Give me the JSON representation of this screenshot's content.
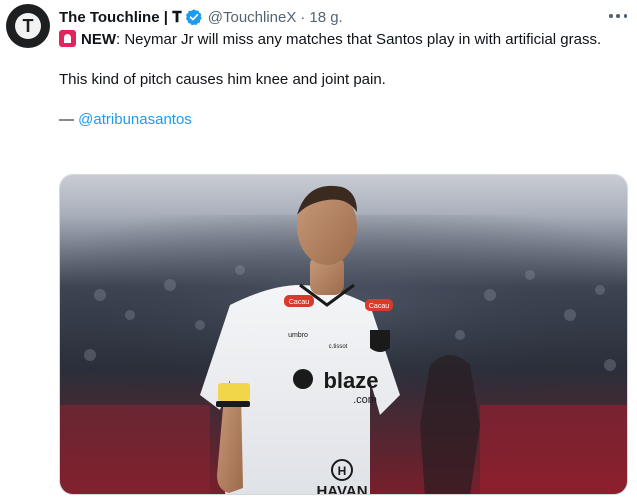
{
  "author": {
    "display_name": "The Touchline | 𝐓",
    "handle": "@TouchlineX",
    "separator": "·",
    "time": "18 g.",
    "avatar_letter": "T",
    "verified": true
  },
  "tweet": {
    "new_label": "NEW",
    "line1_rest": ": Neymar Jr will miss any matches that Santos play in with artificial grass.",
    "paragraph2": "This kind of pitch causes him knee and joint pain.",
    "credit_dash": "— ",
    "credit_link": "@atribunasantos"
  },
  "media": {
    "shirt_sponsor": "blaze",
    "shirt_sponsor_sub": ".com",
    "shirt_brand": "HAVAN",
    "shirt_brand_mark": "H",
    "kit_maker": "umbro",
    "kit_sponsor_small": "c.tissot",
    "patch_text": "Cacau"
  },
  "colors": {
    "link": "#1d9bf0",
    "verified": "#1d9bf0",
    "secondary_text": "#536471",
    "siren": "#e0245e"
  },
  "icons": {
    "verified": "verified-badge-icon",
    "more": "more-options-icon",
    "siren": "siren-emoji-icon"
  }
}
